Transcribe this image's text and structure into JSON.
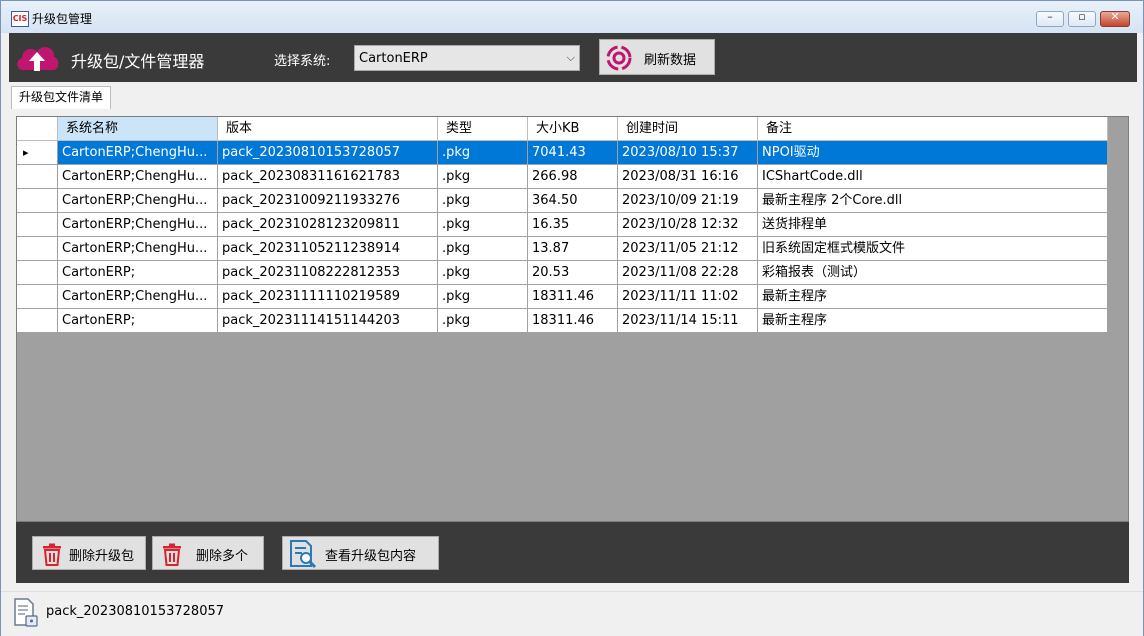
{
  "window": {
    "title": "升级包管理",
    "app_icon_text": "CIS"
  },
  "header": {
    "title": "升级包/文件管理器",
    "system_label": "选择系统:",
    "system_value": "CartonERP",
    "refresh_label": "刷新数据"
  },
  "tabs": [
    {
      "label": "升级包文件清单"
    }
  ],
  "grid": {
    "columns": [
      "系统名称",
      "版本",
      "类型",
      "大小KB",
      "创建时间",
      "备注"
    ],
    "rows": [
      [
        "CartonERP;ChengHu...",
        "pack_20230810153728057",
        ".pkg",
        "7041.43",
        "2023/08/10 15:37",
        "NPOI驱动"
      ],
      [
        "CartonERP;ChengHu...",
        "pack_20230831161621783",
        ".pkg",
        "266.98",
        "2023/08/31 16:16",
        "ICShartCode.dll"
      ],
      [
        "CartonERP;ChengHu...",
        "pack_20231009211933276",
        ".pkg",
        "364.50",
        "2023/10/09 21:19",
        "最新主程序 2个Core.dll"
      ],
      [
        "CartonERP;ChengHu...",
        "pack_20231028123209811",
        ".pkg",
        "16.35",
        "2023/10/28 12:32",
        "送货排程单"
      ],
      [
        "CartonERP;ChengHu...",
        "pack_20231105211238914",
        ".pkg",
        "13.87",
        "2023/11/05 21:12",
        "旧系统固定框式模版文件"
      ],
      [
        "CartonERP;",
        "pack_20231108222812353",
        ".pkg",
        "20.53",
        "2023/11/08 22:28",
        "彩箱报表（测试）"
      ],
      [
        "CartonERP;ChengHu...",
        "pack_20231111110219589",
        ".pkg",
        "18311.46",
        "2023/11/11 11:02",
        "最新主程序"
      ],
      [
        "CartonERP;",
        "pack_20231114151144203",
        ".pkg",
        "18311.46",
        "2023/11/14 15:11",
        "最新主程序"
      ]
    ]
  },
  "actions": {
    "delete_label": "删除升级包",
    "delete_multi_label": "删除多个",
    "view_label": "查看升级包内容"
  },
  "status": {
    "text": "pack_20230810153728057"
  },
  "icons": {
    "cloud": "cloud-upload-icon",
    "refresh": "refresh-icon",
    "trash": "trash-icon",
    "view": "document-search-icon",
    "file": "file-lock-icon"
  },
  "colors": {
    "accent_magenta": "#c0166f",
    "selection_blue": "#0078d7",
    "header_dark": "#3a3a3a",
    "trash_red": "#d9232e",
    "view_blue": "#2a7ab8"
  }
}
